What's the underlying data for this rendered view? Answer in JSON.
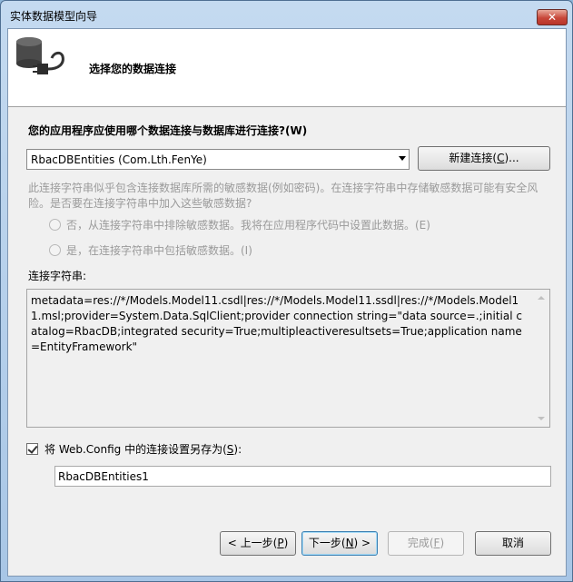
{
  "window": {
    "title": "实体数据模型向导",
    "close_label": "✕"
  },
  "header": {
    "title": "选择您的数据连接",
    "icon": "database-plug-icon"
  },
  "question": {
    "text": "您的应用程序应使用哪个数据连接与数据库进行连接?",
    "accel": "(W)"
  },
  "connection": {
    "selected": "RbacDBEntities (Com.Lth.FenYe)",
    "new_button_prefix": "新建连接(",
    "new_button_key": "C",
    "new_button_suffix": ")..."
  },
  "warning": {
    "line1": "此连接字符串似乎包含连接数据库所需的敏感数据(例如密码)。在连接字符串中存储敏感数据可能有安全风",
    "line2": "险。是否要在连接字符串中加入这些敏感数据?",
    "radio_no": "否，从连接字符串中排除敏感数据。我将在应用程序代码中设置此数据。(E)",
    "radio_yes": "是，在连接字符串中包括敏感数据。(I)"
  },
  "connection_string": {
    "label": "连接字符串:",
    "value": "metadata=res://*/Models.Model11.csdl|res://*/Models.Model11.ssdl|res://*/Models.Model11.msl;provider=System.Data.SqlClient;provider connection string=\"data source=.;initial catalog=RbacDB;integrated security=True;multipleactiveresultsets=True;application name=EntityFramework\""
  },
  "save": {
    "checked": true,
    "label_prefix": "将 Web.Config 中的连接设置另存为(",
    "label_key": "S",
    "label_suffix": "):",
    "name_value": "RbacDBEntities1"
  },
  "buttons": {
    "back_prefix": "< 上一步(",
    "back_key": "P",
    "back_suffix": ")",
    "next_prefix": "下一步(",
    "next_key": "N",
    "next_suffix": ") >",
    "finish_prefix": "完成(",
    "finish_key": "F",
    "finish_suffix": ")",
    "cancel": "取消"
  }
}
